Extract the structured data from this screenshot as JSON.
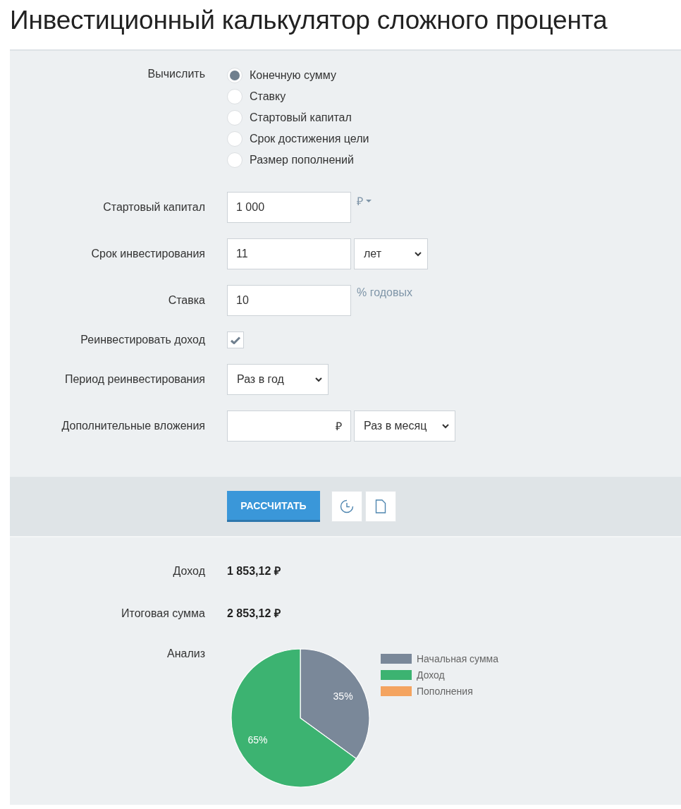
{
  "title": "Инвестиционный калькулятор сложного процента",
  "calculate": {
    "label": "Вычислить",
    "options": [
      {
        "label": "Конечную сумму",
        "selected": true
      },
      {
        "label": "Ставку",
        "selected": false
      },
      {
        "label": "Стартовый капитал",
        "selected": false
      },
      {
        "label": "Срок достижения цели",
        "selected": false
      },
      {
        "label": "Размер пополнений",
        "selected": false
      }
    ]
  },
  "fields": [
    {
      "kind": "input",
      "label": "Стартовый капитал",
      "value": "1 000",
      "unit": "₽",
      "unit_menu": true
    },
    {
      "kind": "input",
      "label": "Срок инвестирования",
      "value": "11",
      "select": "лет"
    },
    {
      "kind": "input",
      "label": "Ставка",
      "value": "10",
      "unit": "% годовых"
    },
    {
      "kind": "checkbox",
      "label": "Реинвестировать доход",
      "checked": true
    },
    {
      "kind": "select",
      "label": "Период реинвестирования",
      "select": "Раз в год"
    },
    {
      "kind": "input",
      "label": "Дополнительные вложения",
      "inner_unit": "₽",
      "select": "Раз в месяц"
    }
  ],
  "actions": {
    "calculate_button": "РАССЧИТАТЬ"
  },
  "results": [
    {
      "label": "Доход",
      "value": "1 853,12 ₽"
    },
    {
      "label": "Итоговая сумма",
      "value": "2 853,12 ₽"
    }
  ],
  "analysis": {
    "label": "Анализ",
    "chart_data": {
      "type": "pie",
      "categories": [
        "Начальная сумма",
        "Доход",
        "Пополнения"
      ],
      "colors": [
        "#7a8899",
        "#3cb371",
        "#f4a460"
      ],
      "legend": "right",
      "series": [
        {
          "values": [
            35,
            65,
            0
          ]
        }
      ],
      "value_labels": [
        "35%",
        "65%",
        null
      ]
    }
  }
}
